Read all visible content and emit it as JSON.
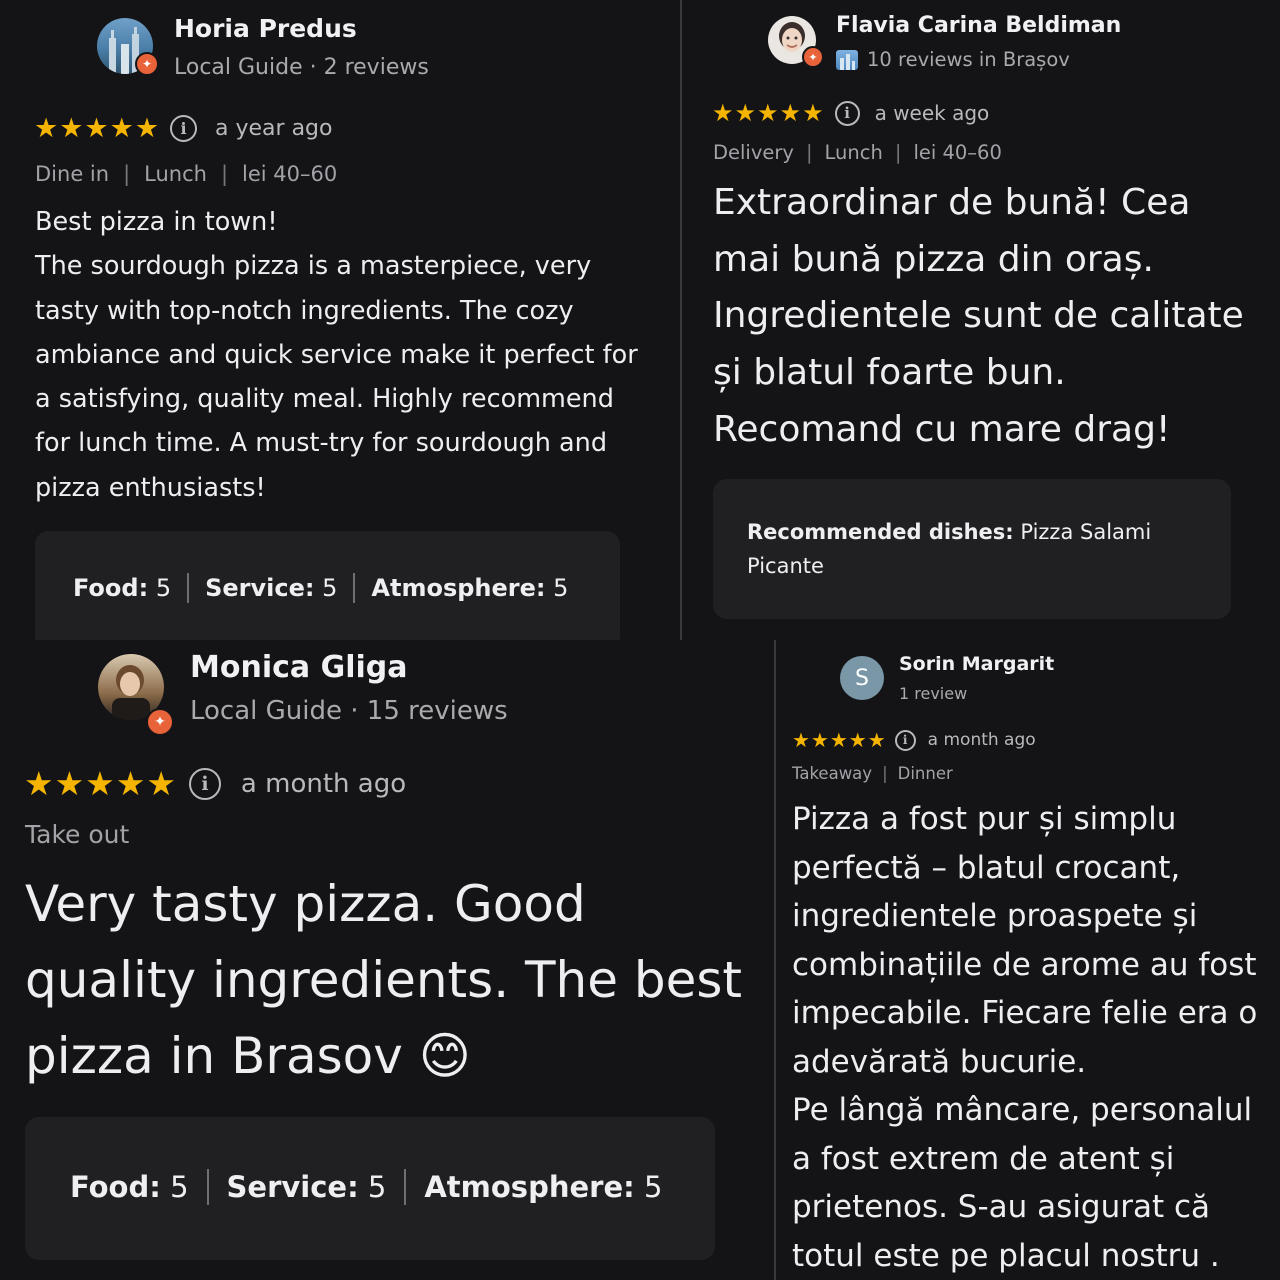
{
  "reviews": [
    {
      "name": "Horia Predus",
      "meta": "Local Guide · 2 reviews",
      "stars": "★★★★★",
      "ago": "a year ago",
      "tags": [
        "Dine in",
        "Lunch",
        "lei 40–60"
      ],
      "text": "Best pizza in town!\nThe sourdough pizza is a masterpiece, very tasty with top-notch ingredients. The cozy ambiance and quick service make it perfect for a satisfying, quality meal. Highly recommend for lunch time. A must-try for sourdough and pizza enthusiasts!",
      "scores": [
        {
          "label": "Food:",
          "value": "5"
        },
        {
          "label": "Service:",
          "value": "5"
        },
        {
          "label": "Atmosphere:",
          "value": "5"
        }
      ]
    },
    {
      "name": "Flavia Carina Beldiman",
      "meta": "10 reviews in Brașov",
      "stars": "★★★★★",
      "ago": "a week ago",
      "tags": [
        "Delivery",
        "Lunch",
        "lei 40–60"
      ],
      "text": "Extraordinar de bună! Cea mai bună pizza din oraș. Ingredientele sunt de calitate și blatul foarte bun.\nRecomand cu mare drag!",
      "recommended_label": "Recommended dishes:",
      "recommended_value": "Pizza Salami Picante"
    },
    {
      "name": "Monica Gliga",
      "meta": "Local Guide · 15 reviews",
      "stars": "★★★★★",
      "ago": "a month ago",
      "tags": [
        "Take out"
      ],
      "text": "Very tasty pizza. Good quality ingredients. The best pizza in Brasov 😊",
      "scores": [
        {
          "label": "Food:",
          "value": "5"
        },
        {
          "label": "Service:",
          "value": "5"
        },
        {
          "label": "Atmosphere:",
          "value": "5"
        }
      ]
    },
    {
      "name": "Sorin Margarit",
      "avatar_letter": "S",
      "meta": "1 review",
      "stars": "★★★★★",
      "ago": "a month ago",
      "tags": [
        "Takeaway",
        "Dinner"
      ],
      "text": "Pizza a fost pur și simplu perfectă – blatul crocant, ingredientele proaspete și combinațiile de arome au fost impecabile. Fiecare felie era o adevărată bucurie.\nPe lângă mâncare, personalul a fost extrem de atent și prietenos. S-au asigurat că totul este pe placul nostru ."
    }
  ],
  "colors": {
    "background": "#151517",
    "star": "#f4b400",
    "badge": "#e8623a",
    "card": "#202023",
    "avatar_s": "#7a97a8"
  },
  "icons": [
    "star-icon",
    "info-icon",
    "local-guide-badge-icon",
    "city-icon"
  ]
}
